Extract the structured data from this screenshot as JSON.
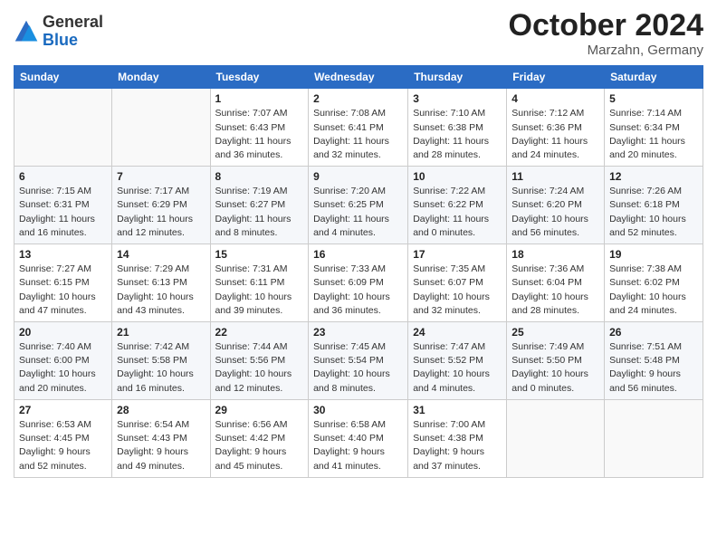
{
  "header": {
    "logo_general": "General",
    "logo_blue": "Blue",
    "month_title": "October 2024",
    "location": "Marzahn, Germany"
  },
  "columns": [
    "Sunday",
    "Monday",
    "Tuesday",
    "Wednesday",
    "Thursday",
    "Friday",
    "Saturday"
  ],
  "weeks": [
    [
      {
        "day": "",
        "info": ""
      },
      {
        "day": "",
        "info": ""
      },
      {
        "day": "1",
        "info": "Sunrise: 7:07 AM\nSunset: 6:43 PM\nDaylight: 11 hours and 36 minutes."
      },
      {
        "day": "2",
        "info": "Sunrise: 7:08 AM\nSunset: 6:41 PM\nDaylight: 11 hours and 32 minutes."
      },
      {
        "day": "3",
        "info": "Sunrise: 7:10 AM\nSunset: 6:38 PM\nDaylight: 11 hours and 28 minutes."
      },
      {
        "day": "4",
        "info": "Sunrise: 7:12 AM\nSunset: 6:36 PM\nDaylight: 11 hours and 24 minutes."
      },
      {
        "day": "5",
        "info": "Sunrise: 7:14 AM\nSunset: 6:34 PM\nDaylight: 11 hours and 20 minutes."
      }
    ],
    [
      {
        "day": "6",
        "info": "Sunrise: 7:15 AM\nSunset: 6:31 PM\nDaylight: 11 hours and 16 minutes."
      },
      {
        "day": "7",
        "info": "Sunrise: 7:17 AM\nSunset: 6:29 PM\nDaylight: 11 hours and 12 minutes."
      },
      {
        "day": "8",
        "info": "Sunrise: 7:19 AM\nSunset: 6:27 PM\nDaylight: 11 hours and 8 minutes."
      },
      {
        "day": "9",
        "info": "Sunrise: 7:20 AM\nSunset: 6:25 PM\nDaylight: 11 hours and 4 minutes."
      },
      {
        "day": "10",
        "info": "Sunrise: 7:22 AM\nSunset: 6:22 PM\nDaylight: 11 hours and 0 minutes."
      },
      {
        "day": "11",
        "info": "Sunrise: 7:24 AM\nSunset: 6:20 PM\nDaylight: 10 hours and 56 minutes."
      },
      {
        "day": "12",
        "info": "Sunrise: 7:26 AM\nSunset: 6:18 PM\nDaylight: 10 hours and 52 minutes."
      }
    ],
    [
      {
        "day": "13",
        "info": "Sunrise: 7:27 AM\nSunset: 6:15 PM\nDaylight: 10 hours and 47 minutes."
      },
      {
        "day": "14",
        "info": "Sunrise: 7:29 AM\nSunset: 6:13 PM\nDaylight: 10 hours and 43 minutes."
      },
      {
        "day": "15",
        "info": "Sunrise: 7:31 AM\nSunset: 6:11 PM\nDaylight: 10 hours and 39 minutes."
      },
      {
        "day": "16",
        "info": "Sunrise: 7:33 AM\nSunset: 6:09 PM\nDaylight: 10 hours and 36 minutes."
      },
      {
        "day": "17",
        "info": "Sunrise: 7:35 AM\nSunset: 6:07 PM\nDaylight: 10 hours and 32 minutes."
      },
      {
        "day": "18",
        "info": "Sunrise: 7:36 AM\nSunset: 6:04 PM\nDaylight: 10 hours and 28 minutes."
      },
      {
        "day": "19",
        "info": "Sunrise: 7:38 AM\nSunset: 6:02 PM\nDaylight: 10 hours and 24 minutes."
      }
    ],
    [
      {
        "day": "20",
        "info": "Sunrise: 7:40 AM\nSunset: 6:00 PM\nDaylight: 10 hours and 20 minutes."
      },
      {
        "day": "21",
        "info": "Sunrise: 7:42 AM\nSunset: 5:58 PM\nDaylight: 10 hours and 16 minutes."
      },
      {
        "day": "22",
        "info": "Sunrise: 7:44 AM\nSunset: 5:56 PM\nDaylight: 10 hours and 12 minutes."
      },
      {
        "day": "23",
        "info": "Sunrise: 7:45 AM\nSunset: 5:54 PM\nDaylight: 10 hours and 8 minutes."
      },
      {
        "day": "24",
        "info": "Sunrise: 7:47 AM\nSunset: 5:52 PM\nDaylight: 10 hours and 4 minutes."
      },
      {
        "day": "25",
        "info": "Sunrise: 7:49 AM\nSunset: 5:50 PM\nDaylight: 10 hours and 0 minutes."
      },
      {
        "day": "26",
        "info": "Sunrise: 7:51 AM\nSunset: 5:48 PM\nDaylight: 9 hours and 56 minutes."
      }
    ],
    [
      {
        "day": "27",
        "info": "Sunrise: 6:53 AM\nSunset: 4:45 PM\nDaylight: 9 hours and 52 minutes."
      },
      {
        "day": "28",
        "info": "Sunrise: 6:54 AM\nSunset: 4:43 PM\nDaylight: 9 hours and 49 minutes."
      },
      {
        "day": "29",
        "info": "Sunrise: 6:56 AM\nSunset: 4:42 PM\nDaylight: 9 hours and 45 minutes."
      },
      {
        "day": "30",
        "info": "Sunrise: 6:58 AM\nSunset: 4:40 PM\nDaylight: 9 hours and 41 minutes."
      },
      {
        "day": "31",
        "info": "Sunrise: 7:00 AM\nSunset: 4:38 PM\nDaylight: 9 hours and 37 minutes."
      },
      {
        "day": "",
        "info": ""
      },
      {
        "day": "",
        "info": ""
      }
    ]
  ]
}
